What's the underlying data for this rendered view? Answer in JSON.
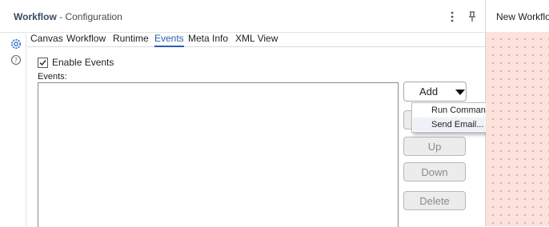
{
  "header": {
    "title_bold": "Workflow",
    "title_sub": "- Configuration",
    "menu_icon": "more-vertical-icon",
    "pin_icon": "pin-icon"
  },
  "sidebar": {
    "icons": [
      "gear-icon",
      "help-icon"
    ]
  },
  "tabs": [
    {
      "label": "Canvas"
    },
    {
      "label": "Workflow"
    },
    {
      "label": "Runtime"
    },
    {
      "label": "Events",
      "active": true
    },
    {
      "label": "Meta Info"
    },
    {
      "label": "XML View"
    }
  ],
  "events_panel": {
    "enable_label": "Enable Events",
    "enable_checked": true,
    "events_label": "Events:",
    "events": []
  },
  "buttons": {
    "add": "Add",
    "up": "Up",
    "down": "Down",
    "delete": "Delete"
  },
  "add_menu": {
    "items": [
      "Run Command...",
      "Send Email..."
    ]
  },
  "right_pane": {
    "tab_label": "New Workflo"
  },
  "colors": {
    "accent": "#2a5fb0",
    "canvas_bg": "#fbe2dc",
    "canvas_dot": "#e0a59a"
  }
}
